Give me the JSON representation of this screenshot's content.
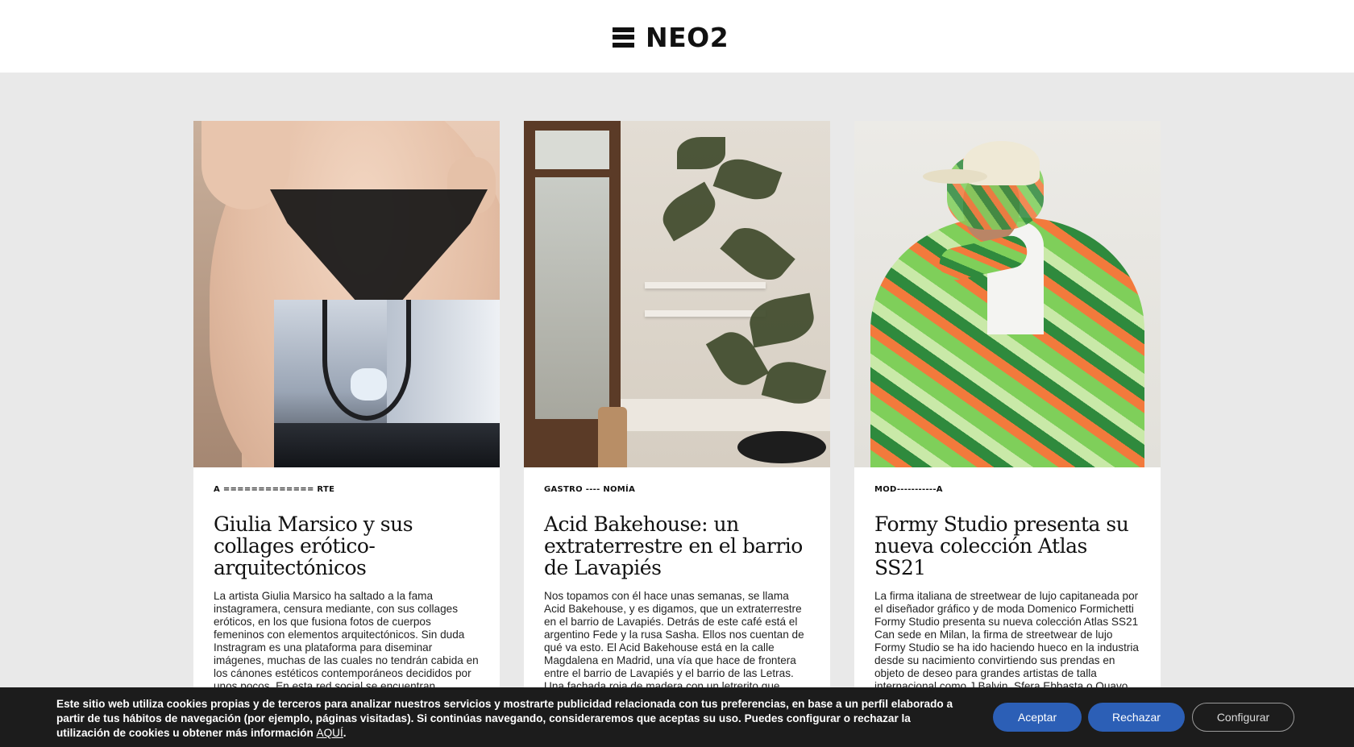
{
  "header": {
    "logo_text": "NEO2",
    "menu_icon": "hamburger-menu-icon"
  },
  "cards": [
    {
      "category": "A ============= RTE",
      "title": "Giulia Marsico y sus collages erótico-arquitectónicos",
      "excerpt": "La artista Giulia Marsico ha saltado a la fama instagramera, censura mediante, con sus collages eróticos, en los que fusiona fotos de cuerpos femeninos con elementos arquitectónicos. Sin duda Instragram es una plataforma para diseminar imágenes, muchas de las cuales no tendrán cabida en los cánones estéticos contemporáneos decididos por unos pocos. En esta red social se encuentran personajes radicales de la cultura juvenil, que..."
    },
    {
      "category": "GASTRO ---- NOMÍA",
      "title": "Acid Bakehouse: un extraterrestre en el barrio de Lavapiés",
      "excerpt": "Nos topamos con él hace unas semanas, se llama Acid Bakehouse, y es digamos, que un extraterrestre en el barrio de Lavapiés. Detrás de este café está el argentino Fede y la rusa Sasha. Ellos nos cuentan de qué va esto. El Acid Bakehouse está en la calle Magdalena en Madrid, una vía que hace de frontera entre el barrio de Lavapiés y el barrio de las Letras. Una fachada roja de madera con un letrerito que podría ser la..."
    },
    {
      "category": "MOD-----------A",
      "title": "Formy Studio presenta su nueva colección Atlas SS21",
      "excerpt": "La firma italiana de streetwear de lujo capitaneada por el diseñador gráfico y de moda Domenico Formichetti Formy Studio presenta su nueva colección Atlas SS21 Can sede en Milan, la firma de streetwear de lujo Formy Studio se ha ido haciendo hueco en la industria desde su nacimiento convirtiendo sus prendas en objeto de deseo para grandes artistas de talla internacional como J Balvin, Sfera Ebbasta o Quavo entre muchos otros. Su creador, el diseñador gráfico y de moda Domenico"
    }
  ],
  "cookie_banner": {
    "text": "Este sitio web utiliza cookies propias y de terceros para analizar nuestros servicios y mostrarte publicidad relacionada con tus preferencias, en base a un perfil elaborado a partir de tus hábitos de navegación (por ejemplo, páginas visitadas). Si continúas navegando, consideraremos que aceptas su uso. Puedes configurar o rechazar la utilización de cookies u obtener más información ",
    "link_text": "AQUÍ",
    "link_suffix": ".",
    "accept_label": "Aceptar",
    "reject_label": "Rechazar",
    "config_label": "Configurar"
  },
  "colors": {
    "background": "#e9e9e9",
    "banner": "#1c1c1c",
    "button_primary": "#2c5fb6"
  }
}
